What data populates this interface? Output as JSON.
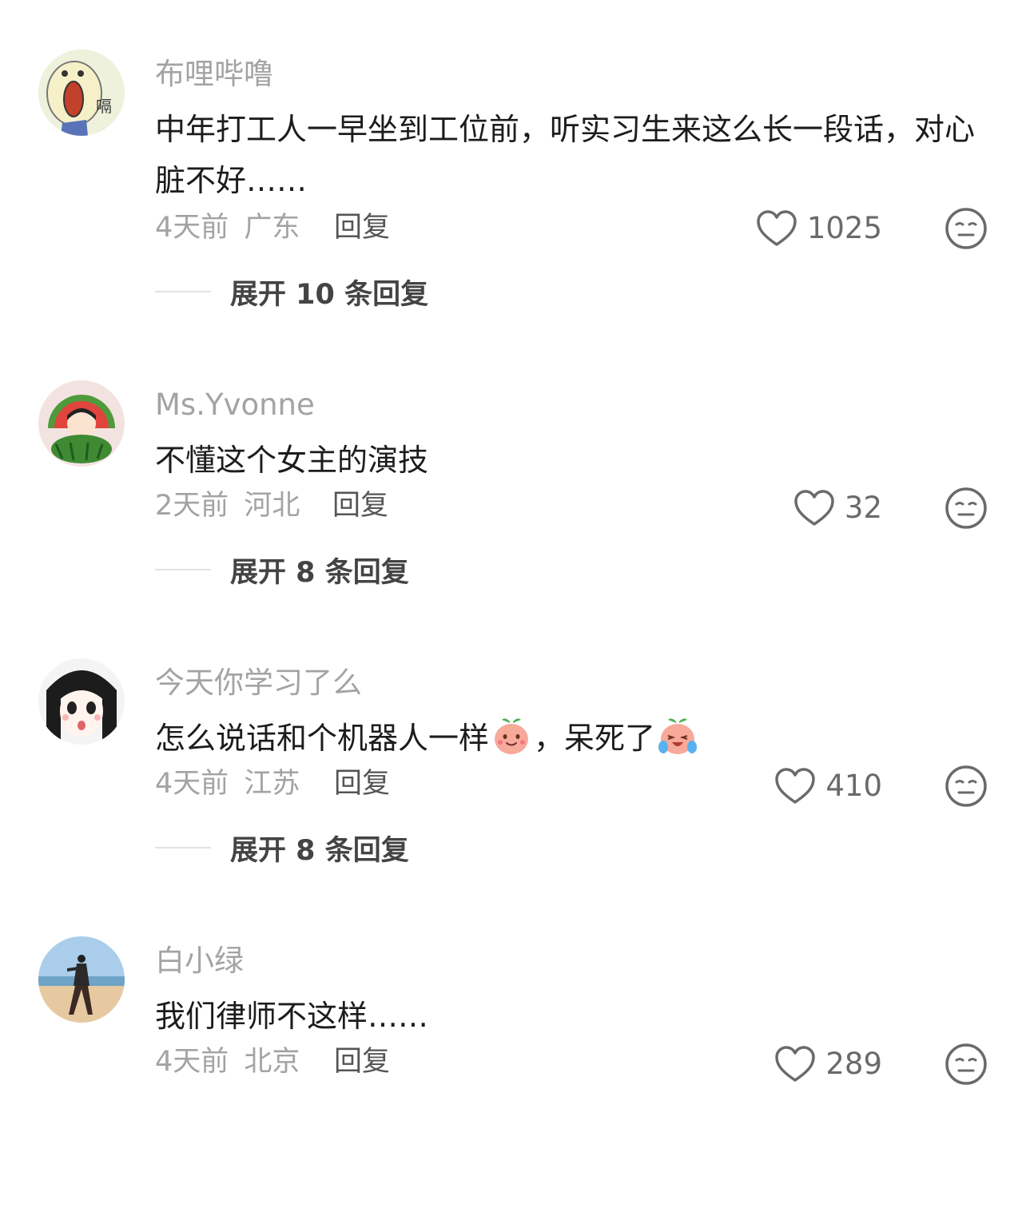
{
  "comments": [
    {
      "username": "布哩哔噜",
      "avatar_badge": "嗝",
      "text": "中年打工人一早坐到工位前，听实习生来这么长一段话，对心脏不好……",
      "time": "4天前",
      "location": "广东",
      "reply_label": "回复",
      "likes": "1025",
      "expand_label": "展开 10 条回复"
    },
    {
      "username": "Ms.Yvonne",
      "text": "不懂这个女主的演技",
      "time": "2天前",
      "location": "河北",
      "reply_label": "回复",
      "likes": "32",
      "expand_label": "展开 8 条回复"
    },
    {
      "username": "今天你学习了么",
      "text_part1": "怎么说话和个机器人一样",
      "text_part2": "，呆死了",
      "emoji1": "smiling-peach-emoji",
      "emoji2": "crying-laughing-peach-emoji",
      "time": "4天前",
      "location": "江苏",
      "reply_label": "回复",
      "likes": "410",
      "expand_label": "展开 8 条回复"
    },
    {
      "username": "白小绿",
      "text": "我们律师不这样……",
      "time": "4天前",
      "location": "北京",
      "reply_label": "回复",
      "likes": "289"
    }
  ],
  "colors": {
    "username": "#a3a3a3",
    "text": "#1c1c1c",
    "meta": "#a3a3a3",
    "icon": "#6a6a6a"
  }
}
